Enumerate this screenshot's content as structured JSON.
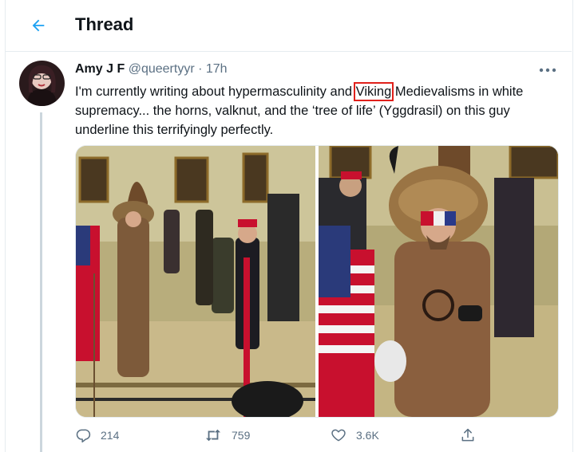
{
  "header": {
    "title": "Thread"
  },
  "tweet": {
    "author_name": "Amy J F",
    "handle": "@queertyyr",
    "separator": "·",
    "time": "17h",
    "text_before": "I'm currently writing about hypermasculinity and ",
    "text_highlight": "Viking",
    "text_after": " Medievalisms in white supremacy... the horns, valknut, and the ‘tree of life’ (Yggdrasil) on this guy underline this terrifyingly perfectly.",
    "stats": {
      "replies": "214",
      "retweets": "759",
      "likes": "3.6K"
    }
  },
  "icons": {
    "back": "arrow-left-icon",
    "more": "more-dots-icon",
    "reply": "reply-bubble-icon",
    "retweet": "retweet-icon",
    "like": "heart-icon",
    "share": "share-icon"
  },
  "colors": {
    "accent": "#1da1f2",
    "muted": "#5b7083",
    "highlight_box": "#e0201b",
    "border": "#e6ecf0"
  }
}
